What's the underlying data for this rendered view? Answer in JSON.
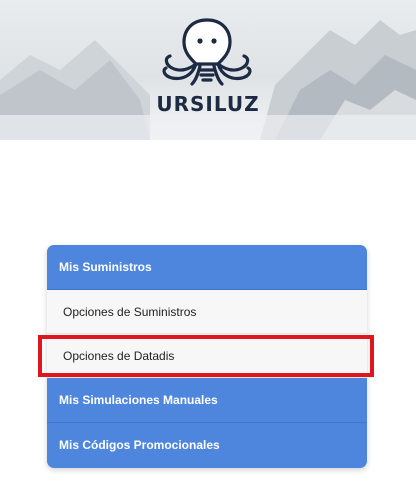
{
  "header": {
    "brand": "URSILUZ",
    "logo_icon": "octopus-lightbulb-icon"
  },
  "menu": {
    "section_1": {
      "label": "Mis Suministros",
      "expanded": true
    },
    "submenu_items": [
      {
        "label": "Opciones de Suministros"
      },
      {
        "label": "Opciones de Datadis",
        "highlighted": true
      }
    ],
    "section_2": {
      "label": "Mis Simulaciones Manuales"
    },
    "section_3": {
      "label": "Mis Códigos Promocionales"
    }
  },
  "colors": {
    "accent": "#4f86dd",
    "highlight": "#e0161e",
    "brand": "#1d2a44"
  }
}
